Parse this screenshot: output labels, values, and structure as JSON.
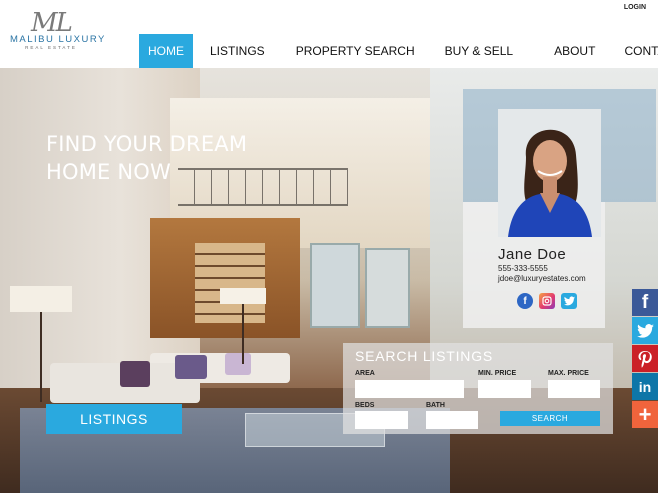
{
  "logo": {
    "mark": "ML",
    "name": "MALIBU LUXURY",
    "tagline": "REAL ESTATE"
  },
  "header": {
    "login": "LOGIN",
    "nav": [
      "HOME",
      "LISTINGS",
      "PROPERTY SEARCH",
      "BUY & SELL",
      "ABOUT",
      "CONTACT"
    ],
    "active_index": 0
  },
  "hero": {
    "title": "FIND YOUR DREAM\nHOME NOW",
    "listings_button": "LISTINGS"
  },
  "agent": {
    "name": "Jane Doe",
    "phone": "555-333-5555",
    "email": "jdoe@luxuryestates.com",
    "social": [
      "facebook-icon",
      "instagram-icon",
      "twitter-icon"
    ]
  },
  "search": {
    "title": "SEARCH LISTINGS",
    "area_label": "AREA",
    "min_price_label": "MIN. PRICE",
    "max_price_label": "MAX. PRICE",
    "beds_label": "BEDS",
    "bath_label": "BATH",
    "button": "SEARCH"
  },
  "share_bar": [
    "facebook-icon",
    "twitter-icon",
    "pinterest-icon",
    "linkedin-icon",
    "plus-icon"
  ],
  "colors": {
    "accent": "#2aa9df",
    "facebook": "#3b5998",
    "pinterest": "#cb2027",
    "linkedin": "#0e76a8",
    "more": "#f0643c"
  }
}
